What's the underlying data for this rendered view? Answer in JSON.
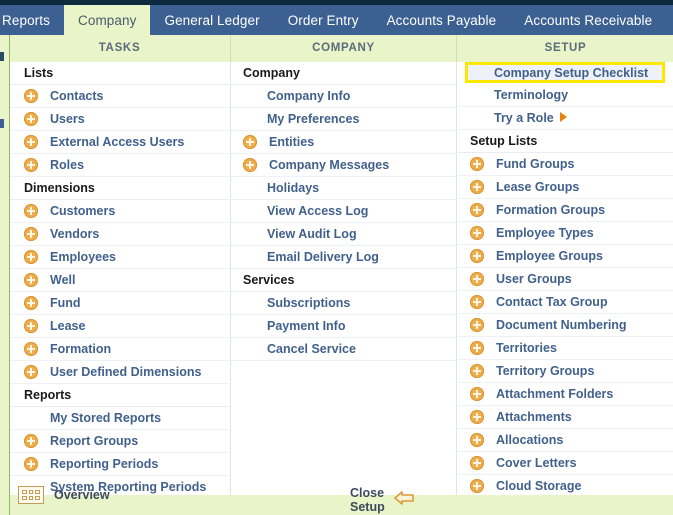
{
  "tabs": [
    {
      "label": "Reports",
      "active": false
    },
    {
      "label": "Company",
      "active": true
    },
    {
      "label": "General Ledger",
      "active": false
    },
    {
      "label": "Order Entry",
      "active": false
    },
    {
      "label": "Accounts Payable",
      "active": false
    },
    {
      "label": "Accounts Receivable",
      "active": false
    }
  ],
  "columns": [
    {
      "header": "TASKS",
      "groups": [
        {
          "title": "Lists",
          "items": [
            {
              "label": "Contacts",
              "plus": true
            },
            {
              "label": "Users",
              "plus": true
            },
            {
              "label": "External Access Users",
              "plus": true
            },
            {
              "label": "Roles",
              "plus": true
            }
          ]
        },
        {
          "title": "Dimensions",
          "items": [
            {
              "label": "Customers",
              "plus": true
            },
            {
              "label": "Vendors",
              "plus": true
            },
            {
              "label": "Employees",
              "plus": true
            },
            {
              "label": "Well",
              "plus": true
            },
            {
              "label": "Fund",
              "plus": true
            },
            {
              "label": "Lease",
              "plus": true
            },
            {
              "label": "Formation",
              "plus": true
            },
            {
              "label": "User Defined Dimensions",
              "plus": true
            }
          ]
        },
        {
          "title": "Reports",
          "items": [
            {
              "label": "My Stored Reports",
              "plus": false
            },
            {
              "label": "Report Groups",
              "plus": true
            },
            {
              "label": "Reporting Periods",
              "plus": true
            },
            {
              "label": "System Reporting Periods",
              "plus": false
            }
          ]
        }
      ]
    },
    {
      "header": "COMPANY",
      "groups": [
        {
          "title": "Company",
          "items": [
            {
              "label": "Company Info",
              "plus": false
            },
            {
              "label": "My Preferences",
              "plus": false
            },
            {
              "label": "Entities",
              "plus": true
            },
            {
              "label": "Company Messages",
              "plus": true
            },
            {
              "label": "Holidays",
              "plus": false
            },
            {
              "label": "View Access Log",
              "plus": false
            },
            {
              "label": "View Audit Log",
              "plus": false
            },
            {
              "label": "Email Delivery Log",
              "plus": false
            }
          ]
        },
        {
          "title": "Services",
          "items": [
            {
              "label": "Subscriptions",
              "plus": false
            },
            {
              "label": "Payment Info",
              "plus": false
            },
            {
              "label": "Cancel Service",
              "plus": false
            }
          ]
        }
      ]
    },
    {
      "header": "SETUP",
      "groups": [
        {
          "title": "",
          "items": [
            {
              "label": "Company Setup Checklist",
              "plus": false,
              "highlighted": true
            },
            {
              "label": "Terminology",
              "plus": false
            },
            {
              "label": "Try a Role",
              "plus": false,
              "arrow": true
            }
          ]
        },
        {
          "title": "Setup Lists",
          "items": [
            {
              "label": "Fund Groups",
              "plus": true
            },
            {
              "label": "Lease Groups",
              "plus": true
            },
            {
              "label": "Formation Groups",
              "plus": true
            },
            {
              "label": "Employee Types",
              "plus": true
            },
            {
              "label": "Employee Groups",
              "plus": true
            },
            {
              "label": "User Groups",
              "plus": true
            },
            {
              "label": "Contact Tax Group",
              "plus": true
            },
            {
              "label": "Document Numbering",
              "plus": true
            },
            {
              "label": "Territories",
              "plus": true
            },
            {
              "label": "Territory Groups",
              "plus": true
            },
            {
              "label": "Attachment Folders",
              "plus": true
            },
            {
              "label": "Attachments",
              "plus": true
            },
            {
              "label": "Allocations",
              "plus": true
            },
            {
              "label": "Cover Letters",
              "plus": true
            },
            {
              "label": "Cloud Storage",
              "plus": true
            }
          ]
        }
      ]
    }
  ],
  "footer": {
    "overview_label": "Overview",
    "overview_icon": "grid-dots-icon",
    "close_label": "Close Setup",
    "close_icon": "back-arrow-icon"
  },
  "colors": {
    "tab_bar": "#3b6091",
    "active_tab_bg": "#eaf4c9",
    "highlight_border": "#ffe800",
    "link_text": "#41618c",
    "plus_icon": "#f0ad4e",
    "arrow_orange": "#e8820c"
  }
}
